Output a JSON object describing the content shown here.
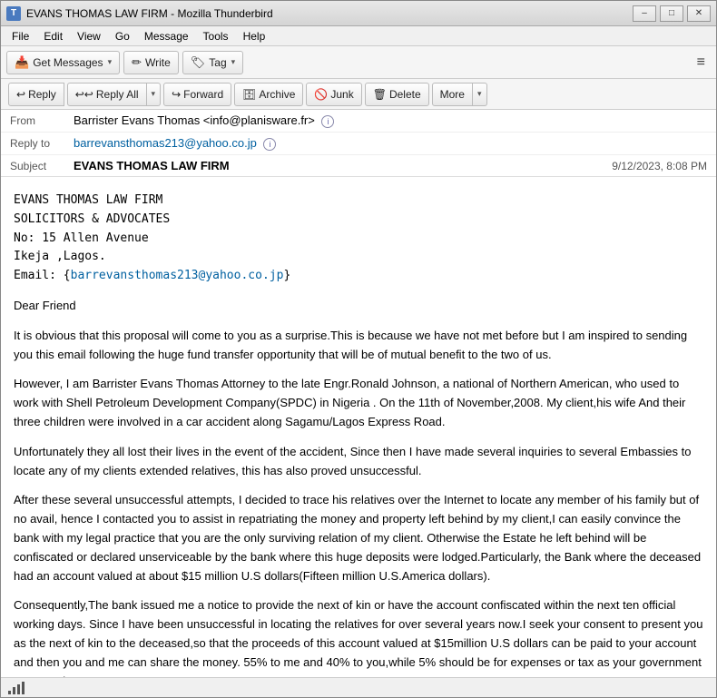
{
  "window": {
    "title": "EVANS THOMAS LAW FIRM - Mozilla Thunderbird",
    "icon_label": "T"
  },
  "window_controls": {
    "minimize": "–",
    "maximize": "□",
    "close": "✕"
  },
  "menu": {
    "items": [
      "File",
      "Edit",
      "View",
      "Go",
      "Message",
      "Tools",
      "Help"
    ]
  },
  "toolbar": {
    "get_messages_label": "Get Messages",
    "write_label": "Write",
    "tag_label": "Tag",
    "hamburger": "≡"
  },
  "email_toolbar": {
    "reply_label": "Reply",
    "reply_all_label": "Reply All",
    "forward_label": "Forward",
    "archive_label": "Archive",
    "junk_label": "Junk",
    "delete_label": "Delete",
    "more_label": "More"
  },
  "email_header": {
    "from_label": "From",
    "from_value": "Barrister Evans Thomas <info@planisware.fr>",
    "reply_to_label": "Reply to",
    "reply_to_value": "barrevansthomas213@yahoo.co.jp",
    "subject_label": "Subject",
    "subject_value": "EVANS THOMAS LAW FIRM",
    "date_value": "9/12/2023, 8:08 PM"
  },
  "email_body": {
    "company_line1": "EVANS THOMAS LAW FIRM",
    "company_line2": "SOLICITORS & ADVOCATES",
    "company_line3": "No: 15 Allen Avenue",
    "company_line4": "Ikeja ,Lagos.",
    "company_line5": "Email: {barrevansthomas213@yahoo.co.jp}",
    "greeting": "Dear Friend",
    "para1": "It is obvious that this proposal will come to you as a surprise.This is because we have not met before but I am inspired to sending you this email following the huge fund transfer opportunity that will be of mutual benefit to the two of us.",
    "para2": "However, I am Barrister Evans Thomas Attorney to the late Engr.Ronald Johnson, a national of Northern American, who used to work with Shell Petroleum Development Company(SPDC) in Nigeria . On the 11th of November,2008. My client,his wife And their three children were involved in a car accident along Sagamu/Lagos Express Road.",
    "para3": "Unfortunately they all lost their lives in the event of the accident, Since then I have made several inquiries to several Embassies to locate any of my clients extended relatives, this has also proved unsuccessful.",
    "para4": "After these several unsuccessful attempts, I decided to trace his relatives over the Internet to locate any member of his family but of no avail, hence I contacted you to assist in repatriating the money and property left behind by my client,I can easily convince the bank with my legal practice that you are the only surviving relation of my client. Otherwise the Estate he left behind will be confiscated or declared unserviceable by the bank where this huge deposits were lodged.Particularly, the Bank where the deceased had an account valued at about $15 million U.S dollars(Fifteen million U.S.America dollars).",
    "para5": "Consequently,The bank issued me a notice to provide the next of kin or have the account confiscated within the next ten official working days. Since I have been unsuccessful in locating the relatives for over several years now.I seek your consent to present you as the next of kin to the deceased,so that the proceeds of this account valued at $15million U.S dollars can be paid to your account and then you and me can share the money. 55% to me and 40% to you,while 5% should be for expenses or tax as your government may require."
  },
  "status_bar": {
    "signal_label": "((·))"
  }
}
